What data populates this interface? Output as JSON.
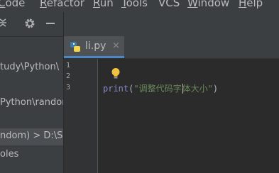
{
  "menu": {
    "items": [
      {
        "mnemonic": "C",
        "rest": "ode"
      },
      {
        "mnemonic": "R",
        "rest": "efactor"
      },
      {
        "mnemonic": "R",
        "rest": "un"
      },
      {
        "mnemonic": "T",
        "rest": "ools"
      },
      {
        "mnemonic": "",
        "rest": "VCS"
      },
      {
        "mnemonic": "W",
        "rest": "indow"
      },
      {
        "mnemonic": "H",
        "rest": "elp"
      }
    ]
  },
  "sidebar": {
    "rows": [
      "tudy\\Python\\",
      "Python\\random",
      "ndom) >  D:\\S",
      "oles"
    ]
  },
  "tab": {
    "label": "li.py",
    "close": "×"
  },
  "gutter": {
    "line_numbers": [
      "1",
      "2",
      "3"
    ]
  },
  "editor": {
    "code": {
      "keyword": "print",
      "open": "(",
      "string_before_caret": "\"调整代码字",
      "string_after_caret": "体大小\"",
      "close": ")"
    }
  },
  "colors": {
    "accent": "#4a88c7",
    "bulb": "#f0c43f",
    "background": "#2b2b2b"
  },
  "icons": [
    "collapse-icon",
    "gear-icon",
    "minimize-icon",
    "python-file-icon",
    "close-icon",
    "intention-bulb-icon"
  ]
}
